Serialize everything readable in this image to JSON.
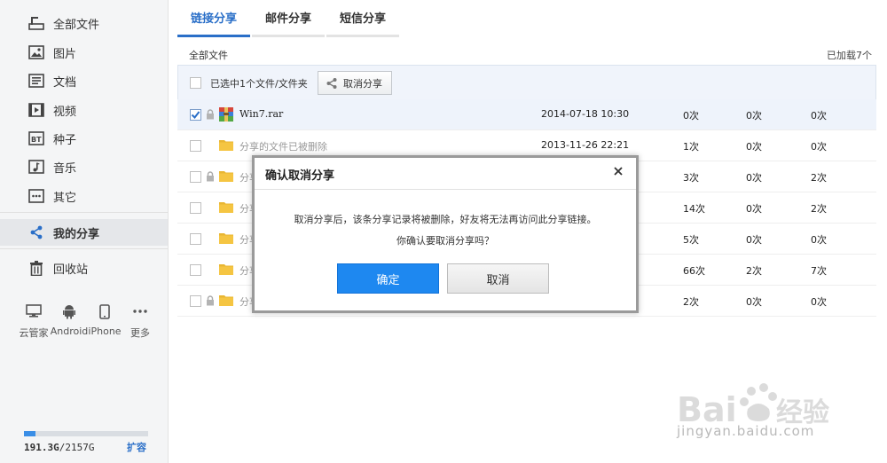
{
  "sidebar": {
    "items": [
      {
        "label": "全部文件",
        "icon": "folder-tree-icon"
      },
      {
        "label": "图片",
        "icon": "image-icon"
      },
      {
        "label": "文档",
        "icon": "document-icon"
      },
      {
        "label": "视频",
        "icon": "video-icon"
      },
      {
        "label": "种子",
        "icon": "bt-icon"
      },
      {
        "label": "音乐",
        "icon": "music-icon"
      },
      {
        "label": "其它",
        "icon": "more-icon"
      },
      {
        "label": "我的分享",
        "icon": "share-icon",
        "active": true
      },
      {
        "label": "回收站",
        "icon": "trash-icon"
      }
    ],
    "devices": [
      {
        "label": "云管家",
        "icon": "monitor-icon"
      },
      {
        "label": "Android",
        "icon": "android-icon"
      },
      {
        "label": "iPhone",
        "icon": "phone-icon"
      },
      {
        "label": "更多",
        "icon": "dots-icon"
      }
    ],
    "quota": {
      "used": "191.3G",
      "total": "/2157G",
      "fraction": 0.09,
      "expand_label": "扩容"
    }
  },
  "tabs": [
    {
      "label": "链接分享",
      "active": true
    },
    {
      "label": "邮件分享"
    },
    {
      "label": "短信分享"
    }
  ],
  "section_title": "全部文件",
  "loaded_count": "已加载7个",
  "selection_bar": {
    "text": "已选中1个文件/文件夹",
    "unshare_label": "取消分享"
  },
  "rows": [
    {
      "name": "Win7.rar",
      "type": "rar",
      "lock": true,
      "checked": true,
      "date": "2014-07-18 10:30",
      "c1": "0次",
      "c2": "0次",
      "c3": "0次"
    },
    {
      "name": "分享的文件已被删除",
      "type": "folder",
      "lock": false,
      "checked": false,
      "date": "2013-11-26 22:21",
      "c1": "1次",
      "c2": "0次",
      "c3": "0次"
    },
    {
      "name": "分享",
      "type": "folder",
      "lock": true,
      "checked": false,
      "date": "",
      "c1": "3次",
      "c2": "0次",
      "c3": "2次"
    },
    {
      "name": "分享",
      "type": "folder",
      "lock": false,
      "checked": false,
      "date": "",
      "c1": "14次",
      "c2": "0次",
      "c3": "2次"
    },
    {
      "name": "分享",
      "type": "folder",
      "lock": false,
      "checked": false,
      "date": "",
      "c1": "5次",
      "c2": "0次",
      "c3": "0次"
    },
    {
      "name": "分享",
      "type": "folder",
      "lock": false,
      "checked": false,
      "date": "",
      "c1": "66次",
      "c2": "2次",
      "c3": "7次"
    },
    {
      "name": "分享",
      "type": "folder",
      "lock": true,
      "checked": false,
      "date": "",
      "c1": "2次",
      "c2": "0次",
      "c3": "0次"
    }
  ],
  "modal": {
    "title": "确认取消分享",
    "message1": "取消分享后，该条分享记录将被删除，好友将无法再访问此分享链接。",
    "message2": "你确认要取消分享吗？",
    "ok_label": "确定",
    "cancel_label": "取消"
  },
  "watermark": {
    "text": "jingyan.baidu.com",
    "logo": "Baidu经验"
  },
  "colors": {
    "accent": "#2a6fc8",
    "ok_button": "#1e88f0",
    "folder": "#f5c542"
  }
}
